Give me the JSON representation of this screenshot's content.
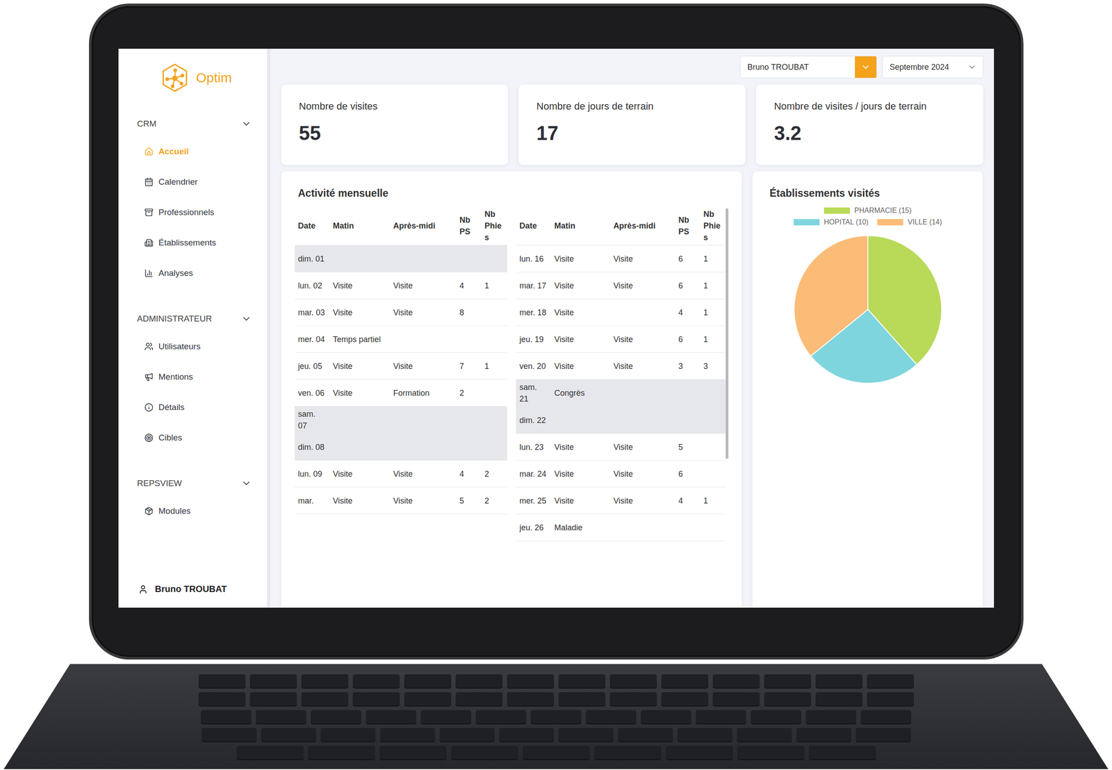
{
  "user_select": {
    "value": "Bruno TROUBAT"
  },
  "month_select": {
    "value": "Septembre 2024"
  },
  "logo": {
    "name": "Optim"
  },
  "sidebar": {
    "sections": [
      {
        "title": "CRM",
        "expanded": true,
        "items": [
          {
            "label": "Accueil",
            "icon": "home",
            "selected": true
          },
          {
            "label": "Calendrier",
            "icon": "calendar",
            "selected": false
          },
          {
            "label": "Professionnels",
            "icon": "archive",
            "selected": false
          },
          {
            "label": "Établissements",
            "icon": "building",
            "selected": false
          },
          {
            "label": "Analyses",
            "icon": "chart",
            "selected": false
          }
        ]
      },
      {
        "title": "ADMINISTRATEUR",
        "expanded": true,
        "items": [
          {
            "label": "Utilisateurs",
            "icon": "users",
            "selected": false
          },
          {
            "label": "Mentions",
            "icon": "megaphone",
            "selected": false
          },
          {
            "label": "Détails",
            "icon": "info",
            "selected": false
          },
          {
            "label": "Cibles",
            "icon": "target",
            "selected": false
          }
        ]
      },
      {
        "title": "REPSVIEW",
        "expanded": true,
        "items": [
          {
            "label": "Modules",
            "icon": "package",
            "selected": false
          }
        ]
      }
    ],
    "user": "Bruno TROUBAT"
  },
  "stats": [
    {
      "label": "Nombre de visites",
      "value": "55"
    },
    {
      "label": "Nombre de jours de terrain",
      "value": "17"
    },
    {
      "label": "Nombre de visites / jours de terrain",
      "value": "3.2"
    }
  ],
  "activity": {
    "title": "Activité mensuelle",
    "columns": [
      "Date",
      "Matin",
      "Après-midi",
      "Nb PS",
      "Nb Phies"
    ],
    "tables": [
      {
        "scrollbar": false,
        "rows": [
          {
            "date": "dim. 01",
            "morning": "",
            "afternoon": "",
            "ps": "",
            "phies": "",
            "weekend": true
          },
          {
            "date": "lun. 02",
            "morning": "Visite",
            "afternoon": "Visite",
            "ps": "4",
            "phies": "1",
            "weekend": false
          },
          {
            "date": "mar. 03",
            "morning": "Visite",
            "afternoon": "Visite",
            "ps": "8",
            "phies": "",
            "weekend": false
          },
          {
            "date": "mer. 04",
            "morning": "Temps partiel",
            "afternoon": "",
            "ps": "",
            "phies": "",
            "weekend": false
          },
          {
            "date": "jeu. 05",
            "morning": "Visite",
            "afternoon": "Visite",
            "ps": "7",
            "phies": "1",
            "weekend": false
          },
          {
            "date": "ven. 06",
            "morning": "Visite",
            "afternoon": "Formation",
            "ps": "2",
            "phies": "",
            "weekend": false
          },
          {
            "date": "sam. 07",
            "morning": "",
            "afternoon": "",
            "ps": "",
            "phies": "",
            "weekend": true
          },
          {
            "date": "dim. 08",
            "morning": "",
            "afternoon": "",
            "ps": "",
            "phies": "",
            "weekend": true
          },
          {
            "date": "lun. 09",
            "morning": "Visite",
            "afternoon": "Visite",
            "ps": "4",
            "phies": "2",
            "weekend": false
          },
          {
            "date": "mar.",
            "morning": "Visite",
            "afternoon": "Visite",
            "ps": "5",
            "phies": "2",
            "weekend": false
          }
        ]
      },
      {
        "scrollbar": true,
        "rows": [
          {
            "date": "lun. 16",
            "morning": "Visite",
            "afternoon": "Visite",
            "ps": "6",
            "phies": "1",
            "weekend": false
          },
          {
            "date": "mar. 17",
            "morning": "Visite",
            "afternoon": "Visite",
            "ps": "6",
            "phies": "1",
            "weekend": false
          },
          {
            "date": "mer. 18",
            "morning": "Visite",
            "afternoon": "",
            "ps": "4",
            "phies": "1",
            "weekend": false
          },
          {
            "date": "jeu. 19",
            "morning": "Visite",
            "afternoon": "Visite",
            "ps": "6",
            "phies": "1",
            "weekend": false
          },
          {
            "date": "ven. 20",
            "morning": "Visite",
            "afternoon": "Visite",
            "ps": "3",
            "phies": "3",
            "weekend": false
          },
          {
            "date": "sam. 21",
            "morning": "Congrès",
            "afternoon": "",
            "ps": "",
            "phies": "",
            "weekend": true
          },
          {
            "date": "dim. 22",
            "morning": "",
            "afternoon": "",
            "ps": "",
            "phies": "",
            "weekend": true
          },
          {
            "date": "lun. 23",
            "morning": "Visite",
            "afternoon": "Visite",
            "ps": "5",
            "phies": "",
            "weekend": false
          },
          {
            "date": "mar. 24",
            "morning": "Visite",
            "afternoon": "Visite",
            "ps": "6",
            "phies": "",
            "weekend": false
          },
          {
            "date": "mer. 25",
            "morning": "Visite",
            "afternoon": "Visite",
            "ps": "4",
            "phies": "1",
            "weekend": false
          },
          {
            "date": "jeu. 26",
            "morning": "Maladie",
            "afternoon": "",
            "ps": "",
            "phies": "",
            "weekend": false
          }
        ]
      }
    ]
  },
  "pie": {
    "title": "Établissements visités",
    "series": [
      {
        "label": "PHARMACIE (15)",
        "value": 15,
        "color": "#b9da58"
      },
      {
        "label": "HOPITAL (10)",
        "value": 10,
        "color": "#7fd5dd"
      },
      {
        "label": "VILLE (14)",
        "value": 14,
        "color": "#fbbc78"
      }
    ]
  }
}
